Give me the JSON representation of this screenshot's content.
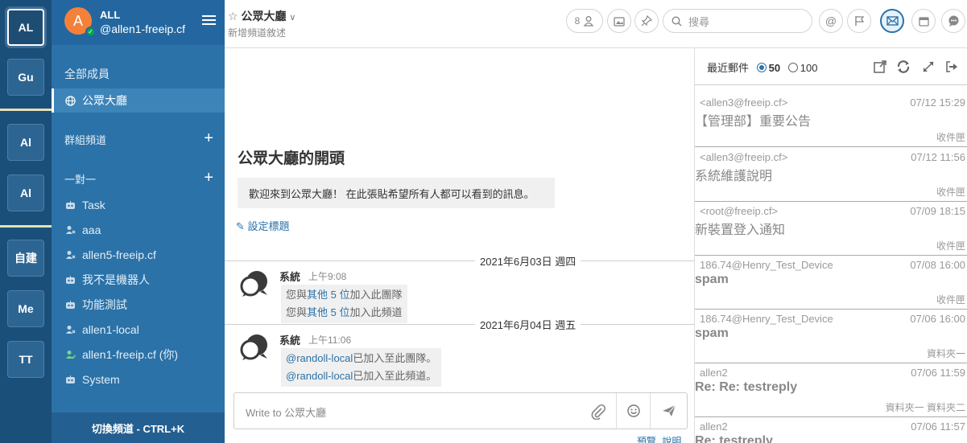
{
  "teams": [
    {
      "label": "AL",
      "active": true
    },
    {
      "label": "Gu"
    },
    {
      "label": "Al"
    },
    {
      "label": "Al"
    },
    {
      "label": "自建"
    },
    {
      "label": "Me"
    },
    {
      "label": "TT"
    }
  ],
  "sidebar": {
    "team_name": "ALL",
    "user_name": "@allen1-freeip.cf",
    "avatar_letter": "A",
    "items_top": [
      {
        "label": "全部成員"
      },
      {
        "label": "公眾大廳",
        "icon": "globe-icon"
      }
    ],
    "section_group": "群組頻道",
    "section_dm": "一對一",
    "dms": [
      {
        "label": "Task",
        "icon": "bot-icon"
      },
      {
        "label": "aaa",
        "icon": "user-icon"
      },
      {
        "label": "allen5-freeip.cf",
        "icon": "user-icon"
      },
      {
        "label": "我不是機器人",
        "icon": "bot-icon"
      },
      {
        "label": "功能測試",
        "icon": "bot-icon"
      },
      {
        "label": "allen1-local",
        "icon": "user-icon"
      },
      {
        "label": "allen1-freeip.cf (你)",
        "icon": "user-icon-online"
      },
      {
        "label": "System",
        "icon": "bot-icon"
      }
    ],
    "switch_label": "切換頻道 - CTRL+K"
  },
  "header": {
    "channel_title": "公眾大廳",
    "purpose": "新增頻道敘述",
    "member_count": "8",
    "search_placeholder": "搜尋"
  },
  "center": {
    "intro_title": "公眾大廳的開頭",
    "intro_text": "歡迎來到公眾大廳！ 在此張貼希望所有人都可以看到的訊息。",
    "set_header": "設定標題",
    "date1": "2021年6月03日 週四",
    "date2": "2021年6月04日 週五",
    "post1": {
      "name": "系統",
      "time": "上午9:08",
      "line1_pre": "您與",
      "line1_link": "其他 5 位",
      "line1_post": "加入此團隊",
      "line2_pre": "您與",
      "line2_link": "其他 5 位",
      "line2_post": "加入此頻道"
    },
    "post2": {
      "name": "系統",
      "time": "上午11:06",
      "line1_link": "@randoll-local",
      "line1_post": "已加入至此團隊。",
      "line2_link": "@randoll-local",
      "line2_post": "已加入至此頻道。"
    },
    "input_placeholder": "Write to 公眾大廳",
    "help_preview": "預覽",
    "help_help": "說明"
  },
  "rhs": {
    "title": "最近郵件",
    "opt_50": "50",
    "opt_100": "100",
    "mails": [
      {
        "from": "<allen3@freeip.cf>",
        "date": "07/12 15:29",
        "subject": "【管理部】重要公告",
        "folder": "收件匣",
        "bold": false
      },
      {
        "from": "<allen3@freeip.cf>",
        "date": "07/12 11:56",
        "subject": "系統維護說明",
        "folder": "收件匣",
        "bold": false
      },
      {
        "from": "<root@freeip.cf>",
        "date": "07/09 18:15",
        "subject": "新裝置登入通知",
        "folder": "收件匣",
        "bold": false
      },
      {
        "from": "186.74@Henry_Test_Device",
        "date": "07/08 16:00",
        "subject": "spam",
        "folder": "收件匣",
        "bold": true
      },
      {
        "from": "186.74@Henry_Test_Device",
        "date": "07/06 16:00",
        "subject": "spam",
        "folder": "資料夾一",
        "bold": true
      },
      {
        "from": "allen2",
        "date": "07/06 11:59",
        "subject": "Re: Re: testreply",
        "folder": "資料夾一 資料夾二",
        "bold": true
      },
      {
        "from": "allen2",
        "date": "07/06 11:57",
        "subject": "Re: testreply",
        "folder": "",
        "bold": true
      }
    ]
  },
  "colors": {
    "team_bar": "#1a4f7a",
    "sidebar": "#2b72a8",
    "accent": "#2b72a8",
    "avatar": "#f4813a",
    "online": "#06a84a"
  }
}
